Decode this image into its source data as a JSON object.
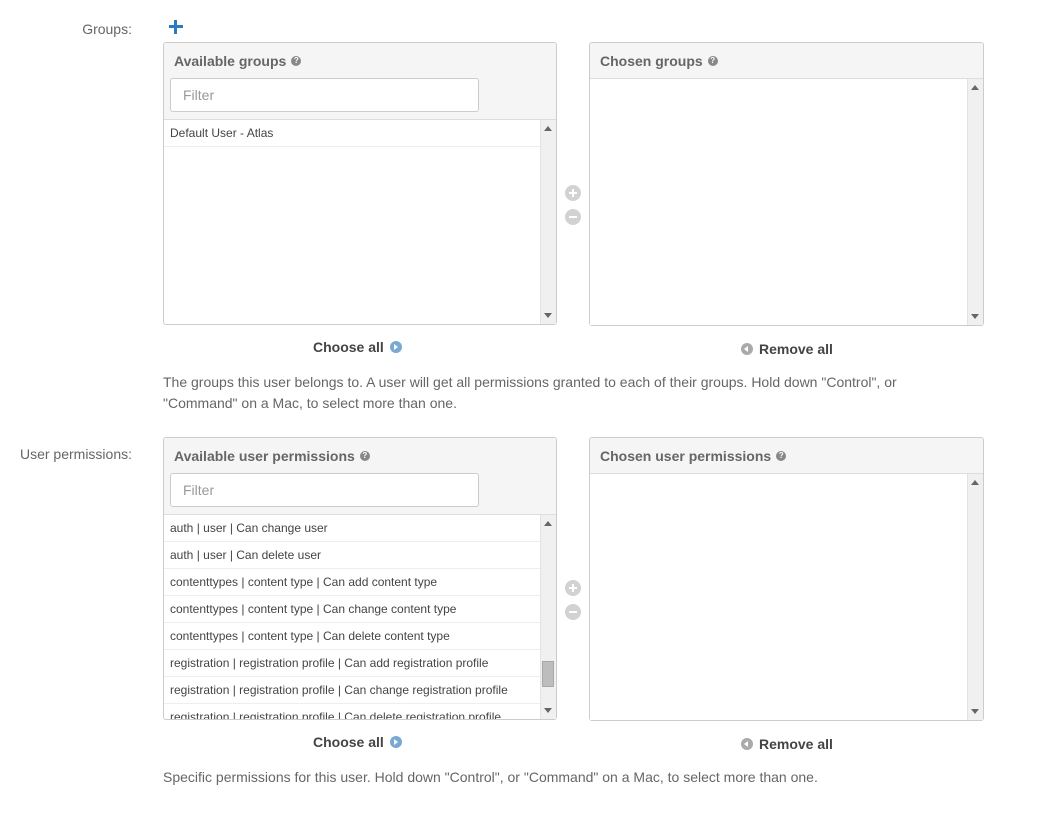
{
  "groups": {
    "label": "Groups:",
    "available_title": "Available groups",
    "chosen_title": "Chosen groups",
    "filter_placeholder": "Filter",
    "items": [
      "Default User - Atlas"
    ],
    "choose_all": "Choose all",
    "remove_all": "Remove all",
    "help_text": "The groups this user belongs to. A user will get all permissions granted to each of their groups. Hold down \"Control\", or \"Command\" on a Mac, to select more than one."
  },
  "permissions": {
    "label": "User permissions:",
    "available_title": "Available user permissions",
    "chosen_title": "Chosen user permissions",
    "filter_placeholder": "Filter",
    "items": [
      "auth | user | Can change user",
      "auth | user | Can delete user",
      "contenttypes | content type | Can add content type",
      "contenttypes | content type | Can change content type",
      "contenttypes | content type | Can delete content type",
      "registration | registration profile | Can add registration profile",
      "registration | registration profile | Can change registration profile",
      "registration | registration profile | Can delete registration profile"
    ],
    "choose_all": "Choose all",
    "remove_all": "Remove all",
    "help_text": "Specific permissions for this user. Hold down \"Control\", or \"Command\" on a Mac, to select more than one."
  },
  "icons": {
    "add": "plus-icon",
    "help": "question-circle-icon",
    "move_right": "add-circle-icon",
    "move_left": "remove-circle-icon",
    "choose_all": "arrow-right-circle-icon",
    "remove_all": "arrow-left-circle-icon"
  },
  "colors": {
    "accent": "#2a7bc0",
    "choose_icon": "#79a9d3",
    "remove_icon": "#aaaaaa"
  }
}
